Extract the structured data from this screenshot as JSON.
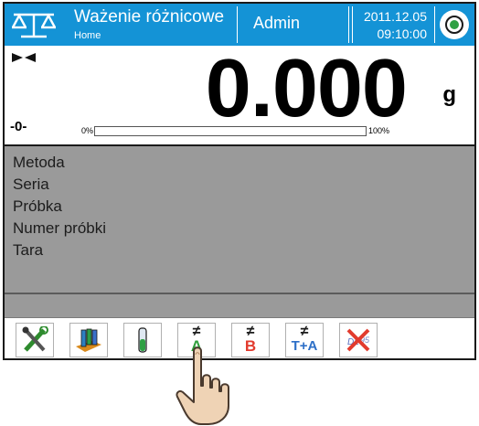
{
  "header": {
    "mode_title": "Ważenie różnicowe",
    "mode_subtitle": "Home",
    "user": "Admin",
    "date": "2011.12.05",
    "time": "09:10:00",
    "logo_icon": "balance-logo-icon",
    "status_icon": "status-ok-icon"
  },
  "weighing": {
    "value": "0.000",
    "unit": "g",
    "zero_indicator": "-0-",
    "progress_min_label": "0%",
    "progress_max_label": "100%",
    "progress_fraction": 0
  },
  "info": {
    "rows": [
      "Metoda",
      "Seria",
      "Próbka",
      "Numer próbki",
      "Tara"
    ]
  },
  "toolbar": {
    "buttons": [
      {
        "icon": "settings-tools-icon"
      },
      {
        "icon": "sample-tubes-icon"
      },
      {
        "icon": "single-tube-icon"
      },
      {
        "icon": "difference-a-icon",
        "symbol": "≠",
        "label": "A"
      },
      {
        "icon": "difference-b-icon",
        "symbol": "≠",
        "label": "B"
      },
      {
        "icon": "difference-ta-icon",
        "symbol": "≠",
        "label": "T+A"
      },
      {
        "icon": "delete-series-icon"
      }
    ]
  },
  "colors": {
    "header_bg": "#1493d6",
    "info_bg": "#9a9a9a",
    "accent_green": "#2ea043",
    "accent_red": "#e23b2e"
  }
}
